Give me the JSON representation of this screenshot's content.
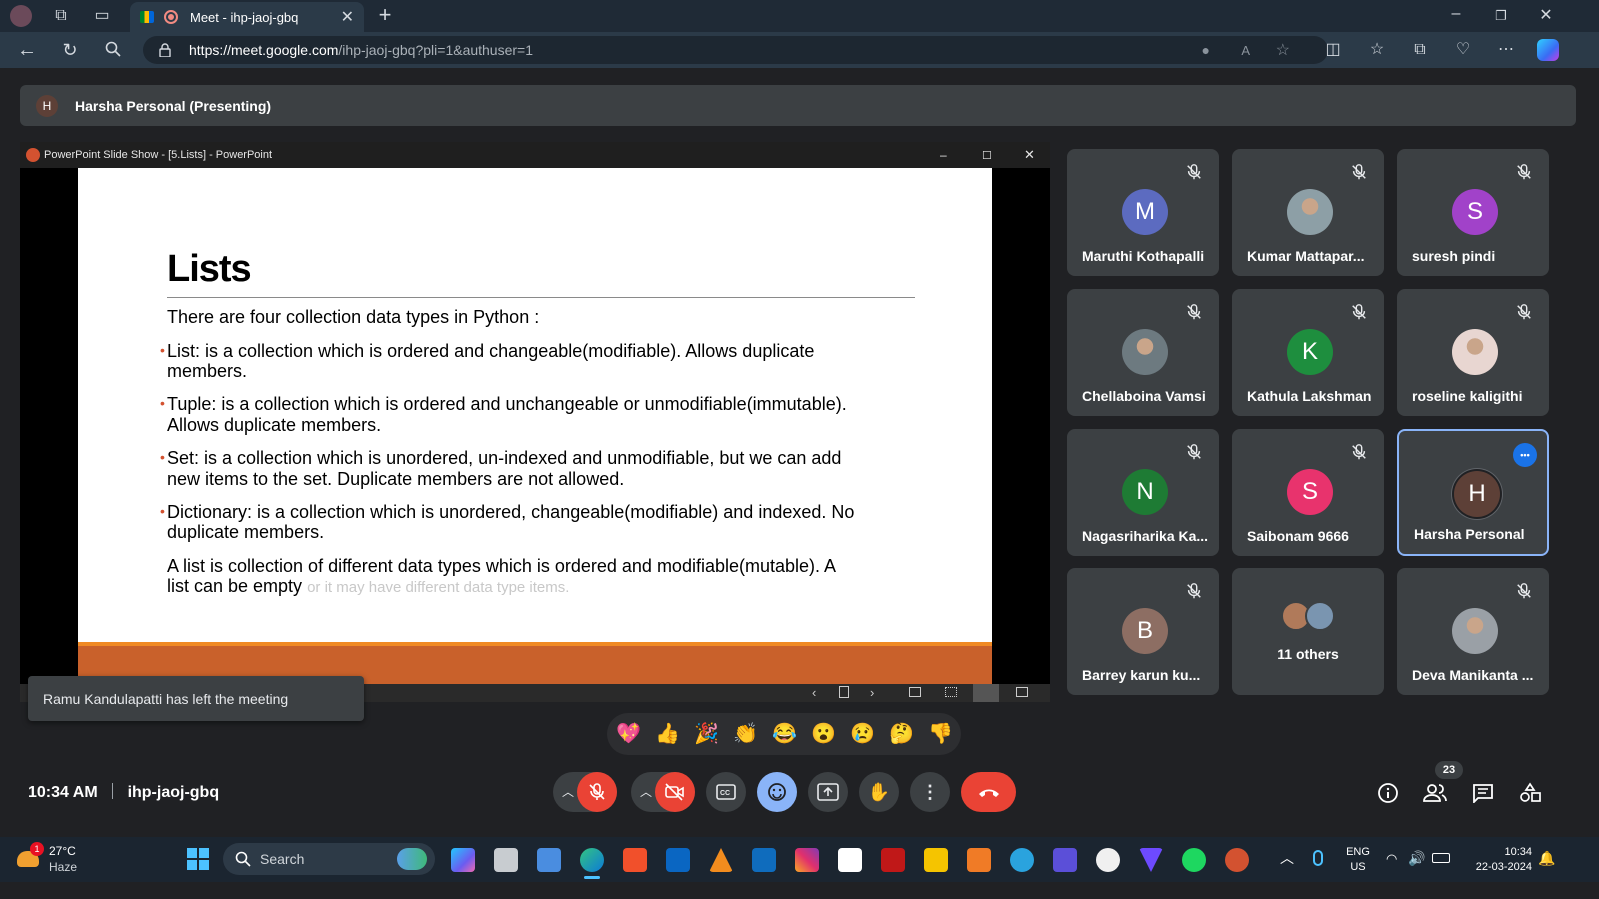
{
  "browser": {
    "tab_title": "Meet - ihp-jaoj-gbq",
    "url_domain": "https://meet.google.com",
    "url_path": "/ihp-jaoj-gbq?pli=1&authuser=1"
  },
  "presenting_bar": {
    "initial": "H",
    "label": "Harsha Personal (Presenting)"
  },
  "ppt": {
    "window_title": "PowerPoint Slide Show - [5.Lists] - PowerPoint",
    "slide_title": "Lists",
    "intro": "There are four collection data types in Python :",
    "bullet1a": "List: is a collection which is ordered and changeable(modifiable). Allows duplicate",
    "bullet1b": "members.",
    "bullet2a": "Tuple: is a collection which is ordered and unchangeable or unmodifiable(immutable).",
    "bullet2b": "Allows duplicate members.",
    "bullet3a": "Set: is a collection which is unordered, un-indexed and unmodifiable, but we can add",
    "bullet3b": "new items to the set. Duplicate members are not allowed.",
    "bullet4a": "Dictionary: is a collection which is unordered, changeable(modifiable) and indexed. No",
    "bullet4b": "duplicate members.",
    "para_a": "A list is collection of different data types which is ordered and modifiable(mutable). A",
    "para_b": "list can be empty",
    "para_faded": "or it may have different data type items."
  },
  "participants": [
    {
      "name": "Maruthi Kothapalli",
      "initial": "M",
      "color": "#5c6bc0",
      "muted": true
    },
    {
      "name": "Kumar Mattapar...",
      "initial": "",
      "color": "#8d9fa6",
      "muted": true
    },
    {
      "name": "suresh pindi",
      "initial": "S",
      "color": "#a142c9",
      "muted": true
    },
    {
      "name": "Chellaboina Vamsi",
      "initial": "",
      "color": "#6d7a80",
      "muted": true
    },
    {
      "name": "Kathula Lakshman",
      "initial": "K",
      "color": "#1e8e3e",
      "muted": true
    },
    {
      "name": "roseline kaligithi",
      "initial": "",
      "color": "#e8d6d1",
      "muted": true
    },
    {
      "name": "Nagasriharika Ka...",
      "initial": "N",
      "color": "#1e7b34",
      "muted": true
    },
    {
      "name": "Saibonam 9666",
      "initial": "S",
      "color": "#e8336d",
      "muted": true
    },
    {
      "name": "Harsha Personal",
      "initial": "H",
      "color": "#5d4037",
      "muted": false
    },
    {
      "name": "Barrey karun ku...",
      "initial": "B",
      "color": "#8d6e63",
      "muted": true
    },
    {
      "name": "11 others",
      "initial": "",
      "color": "#7b8b93",
      "muted": false
    },
    {
      "name": "Deva Manikanta ...",
      "initial": "",
      "color": "#9aa0a6",
      "muted": true
    }
  ],
  "toast": "Ramu Kandulapatti has left the meeting",
  "meeting": {
    "time": "10:34 AM",
    "code": "ihp-jaoj-gbq",
    "people_count": "23"
  },
  "taskbar": {
    "weather_temp": "27°C",
    "weather_desc": "Haze",
    "weather_badge": "1",
    "search_placeholder": "Search",
    "lang1": "ENG",
    "lang2": "US",
    "clock_time": "10:34",
    "clock_date": "22-03-2024"
  }
}
